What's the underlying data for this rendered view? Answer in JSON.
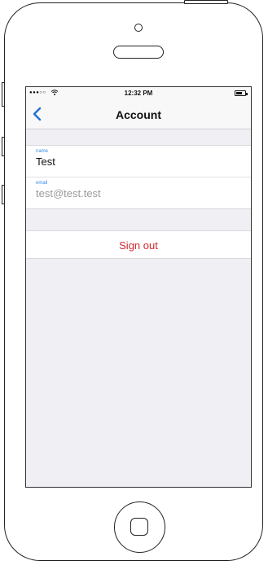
{
  "statusbar": {
    "signal": "●●●○○",
    "time": "12:32 PM"
  },
  "navbar": {
    "back_icon": "chevron-left-icon",
    "title": "Account"
  },
  "fields": {
    "name": {
      "label": "name",
      "value": "Test"
    },
    "email": {
      "label": "email",
      "value": "test@test.test"
    }
  },
  "actions": {
    "sign_out_label": "Sign out"
  },
  "colors": {
    "accent": "#3a8ee6",
    "destructive": "#d0282f",
    "background": "#efeff4"
  }
}
